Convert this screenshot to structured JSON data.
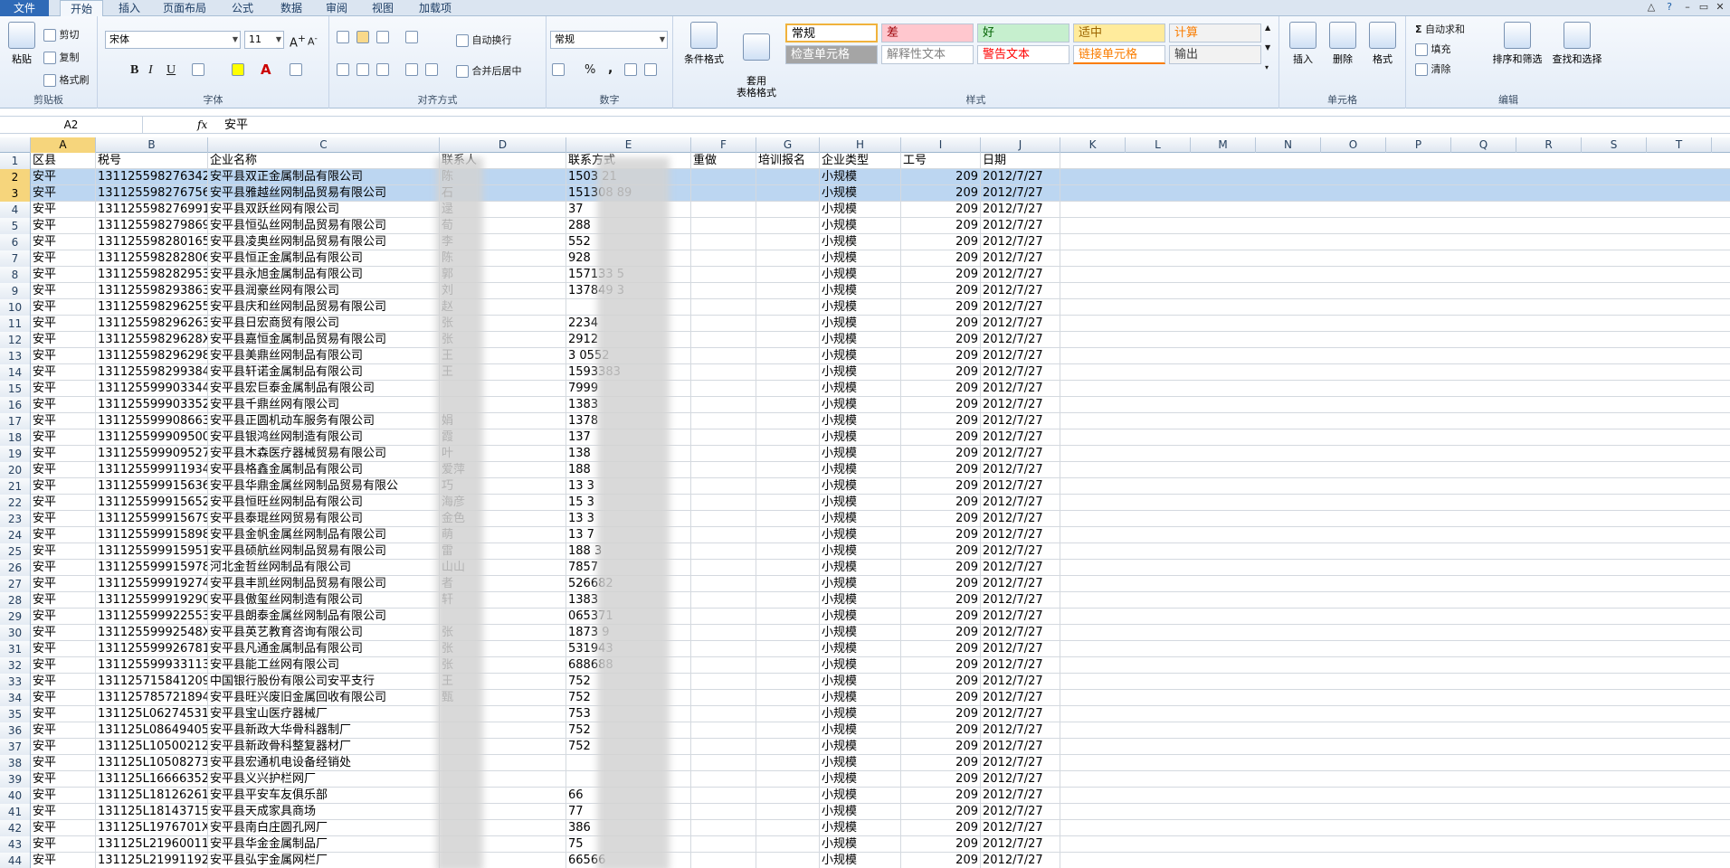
{
  "ribbon_tabs": [
    "文件",
    "开始",
    "插入",
    "页面布局",
    "公式",
    "数据",
    "审阅",
    "视图",
    "加载项"
  ],
  "clipboard": {
    "paste": "粘贴",
    "cut": "剪切",
    "copy": "复制",
    "format_painter": "格式刷",
    "label": "剪贴板"
  },
  "font": {
    "name": "宋体",
    "size": "11",
    "bold": "B",
    "italic": "I",
    "underline": "U",
    "label": "字体"
  },
  "alignment": {
    "wrap": "自动换行",
    "merge": "合并后居中",
    "label": "对齐方式"
  },
  "number": {
    "format": "常规",
    "percent": "%",
    "comma": ",",
    "label": "数字"
  },
  "styles": {
    "conditional": "条件格式",
    "table": "套用\n表格格式",
    "label": "样式",
    "items": [
      {
        "text": "常规",
        "bg": "#ffffff",
        "fg": "#000000"
      },
      {
        "text": "差",
        "bg": "#ffc7ce",
        "fg": "#9c0006"
      },
      {
        "text": "好",
        "bg": "#c6efce",
        "fg": "#006100"
      },
      {
        "text": "适中",
        "bg": "#ffeb9c",
        "fg": "#9c6500"
      },
      {
        "text": "计算",
        "bg": "#f2f2f2",
        "fg": "#fa7d00"
      },
      {
        "text": "检查单元格",
        "bg": "#a5a5a5",
        "fg": "#ffffff"
      },
      {
        "text": "解释性文本",
        "bg": "#ffffff",
        "fg": "#7f7f7f"
      },
      {
        "text": "警告文本",
        "bg": "#ffffff",
        "fg": "#ff0000"
      },
      {
        "text": "链接单元格",
        "bg": "#ffffff",
        "fg": "#fa7d00"
      },
      {
        "text": "输出",
        "bg": "#f2f2f2",
        "fg": "#3f3f3f"
      }
    ]
  },
  "cells_group": {
    "insert": "插入",
    "delete": "删除",
    "format": "格式",
    "label": "单元格"
  },
  "editing": {
    "autosum": "自动求和",
    "fill": "填充",
    "clear": "清除",
    "sort": "排序和筛选",
    "find": "查找和选择",
    "label": "编辑"
  },
  "formula_bar": {
    "name_box": "A2",
    "fx": "fx",
    "value": "安平"
  },
  "columns": [
    "A",
    "B",
    "C",
    "D",
    "E",
    "F",
    "G",
    "H",
    "I",
    "J",
    "K",
    "L",
    "M",
    "N",
    "O",
    "P",
    "Q",
    "R",
    "S",
    "T"
  ],
  "header_row": [
    "区县",
    "税号",
    "企业名称",
    "联系人",
    "联系方式",
    "重做",
    "培训报名",
    "企业类型",
    "工号",
    "日期"
  ],
  "rows": [
    [
      "2",
      "安平",
      "131125598276342",
      "安平县双正金属制品有限公司",
      "陈",
      "1503 21",
      "",
      "",
      "小规模",
      "209",
      "2012/7/27"
    ],
    [
      "3",
      "安平",
      "131125598276756",
      "安平县雅越丝网制品贸易有限公司",
      "石",
      "151308 89",
      "",
      "",
      "小规模",
      "209",
      "2012/7/27"
    ],
    [
      "4",
      "安平",
      "131125598276991",
      "安平县双跃丝网有限公司",
      "逯",
      " 37",
      "",
      "",
      "小规模",
      "209",
      "2012/7/27"
    ],
    [
      "5",
      "安平",
      "131125598279869",
      "安平县恒弘丝网制品贸易有限公司",
      "荀",
      " 288",
      "",
      "",
      "小规模",
      "209",
      "2012/7/27"
    ],
    [
      "6",
      "安平",
      "131125598280165",
      "安平县凌奥丝网制品贸易有限公司",
      "李",
      " 552",
      "",
      "",
      "小规模",
      "209",
      "2012/7/27"
    ],
    [
      "7",
      "安平",
      "131125598282806",
      "安平县恒正金属制品有限公司",
      "陈",
      " 928",
      "",
      "",
      "小规模",
      "209",
      "2012/7/27"
    ],
    [
      "8",
      "安平",
      "131125598282953",
      "安平县永旭金属制品有限公司",
      "郭",
      "157133 5",
      "",
      "",
      "小规模",
      "209",
      "2012/7/27"
    ],
    [
      "9",
      "安平",
      "131125598293863",
      "安平县润豪丝网有限公司",
      "刘",
      "137849 3",
      "",
      "",
      "小规模",
      "209",
      "2012/7/27"
    ],
    [
      "10",
      "安平",
      "131125598296255",
      "安平县庆和丝网制品贸易有限公司",
      "赵",
      "",
      "",
      "",
      "小规模",
      "209",
      "2012/7/27"
    ],
    [
      "11",
      "安平",
      "131125598296263",
      "安平县日宏商贸有限公司",
      "张",
      " 2234",
      "",
      "",
      "小规模",
      "209",
      "2012/7/27"
    ],
    [
      "12",
      "安平",
      "13112559829628X",
      "安平县嘉恒金属制品贸易有限公司",
      "张",
      " 2912",
      "",
      "",
      "小规模",
      "209",
      "2012/7/27"
    ],
    [
      "13",
      "安平",
      "131125598296298",
      "安平县美鼎丝网制品有限公司",
      "王",
      "3 0552",
      "",
      "",
      "小规模",
      "209",
      "2012/7/27"
    ],
    [
      "14",
      "安平",
      "131125598299384",
      "安平县轩诺金属制品有限公司",
      "王",
      "1593383",
      "",
      "",
      "小规模",
      "209",
      "2012/7/27"
    ],
    [
      "15",
      "安平",
      "131125599903344",
      "安平县宏巨泰金属制品有限公司",
      "",
      "7999",
      "",
      "",
      "小规模",
      "209",
      "2012/7/27"
    ],
    [
      "16",
      "安平",
      "131125599903352",
      "安平县千鼎丝网有限公司",
      "",
      "1383",
      "",
      "",
      "小规模",
      "209",
      "2012/7/27"
    ],
    [
      "17",
      "安平",
      "131125599908663",
      "安平县正圆机动车服务有限公司",
      "娟",
      "1378",
      "",
      "",
      "小规模",
      "209",
      "2012/7/27"
    ],
    [
      "18",
      "安平",
      "131125599909500",
      "安平县银鸿丝网制造有限公司",
      "霞",
      "137",
      "",
      "",
      "小规模",
      "209",
      "2012/7/27"
    ],
    [
      "19",
      "安平",
      "131125599909527",
      "安平县木森医疗器械贸易有限公司",
      "叶",
      "138",
      "",
      "",
      "小规模",
      "209",
      "2012/7/27"
    ],
    [
      "20",
      "安平",
      "131125599911934",
      "安平县格鑫金属制品有限公司",
      "爱萍",
      "188",
      "",
      "",
      "小规模",
      "209",
      "2012/7/27"
    ],
    [
      "21",
      "安平",
      "131125599915636",
      "安平县华鼎金属丝网制品贸易有限公",
      "巧",
      "13 3",
      "",
      "",
      "小规模",
      "209",
      "2012/7/27"
    ],
    [
      "22",
      "安平",
      "131125599915652",
      "安平县恒旺丝网制品有限公司",
      "海彦",
      "15 3",
      "",
      "",
      "小规模",
      "209",
      "2012/7/27"
    ],
    [
      "23",
      "安平",
      "131125599915679",
      "安平县泰琨丝网贸易有限公司",
      "金色",
      "13 3",
      "",
      "",
      "小规模",
      "209",
      "2012/7/27"
    ],
    [
      "24",
      "安平",
      "131125599915898",
      "安平县金帆金属丝网制品有限公司",
      "萌",
      "13 7",
      "",
      "",
      "小规模",
      "209",
      "2012/7/27"
    ],
    [
      "25",
      "安平",
      "131125599915951",
      "安平县硕航丝网制品贸易有限公司",
      "雷",
      "188 3",
      "",
      "",
      "小规模",
      "209",
      "2012/7/27"
    ],
    [
      "26",
      "安平",
      "131125599915978",
      "河北金哲丝网制品有限公司",
      "山山",
      "7857",
      "",
      "",
      "小规模",
      "209",
      "2012/7/27"
    ],
    [
      "27",
      "安平",
      "131125599919274",
      "安平县丰凯丝网制品贸易有限公司",
      "者",
      "526682",
      "",
      "",
      "小规模",
      "209",
      "2012/7/27"
    ],
    [
      "28",
      "安平",
      "131125599919290",
      "安平县傲玺丝网制造有限公司",
      "轩",
      "1383",
      "",
      "",
      "小规模",
      "209",
      "2012/7/27"
    ],
    [
      "29",
      "安平",
      "131125599922553",
      "安平县朗泰金属丝网制品有限公司",
      "",
      "065371",
      "",
      "",
      "小规模",
      "209",
      "2012/7/27"
    ],
    [
      "30",
      "安平",
      "13112559992548X",
      "安平县英艺教育咨询有限公司",
      "张",
      "1873 9",
      "",
      "",
      "小规模",
      "209",
      "2012/7/27"
    ],
    [
      "31",
      "安平",
      "131125599926781",
      "安平县凡通金属制品有限公司",
      "张",
      "531943",
      "",
      "",
      "小规模",
      "209",
      "2012/7/27"
    ],
    [
      "32",
      "安平",
      "131125599933113",
      "安平县能工丝网有限公司",
      "张",
      "688688",
      "",
      "",
      "小规模",
      "209",
      "2012/7/27"
    ],
    [
      "33",
      "安平",
      "131125715841209",
      "中国银行股份有限公司安平支行",
      "王",
      "752",
      "",
      "",
      "小规模",
      "209",
      "2012/7/27"
    ],
    [
      "34",
      "安平",
      "131125785721894",
      "安平县旺兴废旧金属回收有限公司",
      "甄",
      "752",
      "",
      "",
      "小规模",
      "209",
      "2012/7/27"
    ],
    [
      "35",
      "安平",
      "131125L06274531",
      "安平县宝山医疗器械厂",
      "",
      "753",
      "",
      "",
      "小规模",
      "209",
      "2012/7/27"
    ],
    [
      "36",
      "安平",
      "131125L08649405",
      "安平县新政大华骨科器制厂",
      "",
      "752",
      "",
      "",
      "小规模",
      "209",
      "2012/7/27"
    ],
    [
      "37",
      "安平",
      "131125L10500212",
      "安平县新政骨科整复器材厂",
      "",
      "752",
      "",
      "",
      "小规模",
      "209",
      "2012/7/27"
    ],
    [
      "38",
      "安平",
      "131125L10508273",
      "安平县宏通机电设备经销处",
      "",
      "",
      "",
      "",
      "小规模",
      "209",
      "2012/7/27"
    ],
    [
      "39",
      "安平",
      "131125L16666352",
      "安平县义兴护栏网厂",
      "",
      "",
      "",
      "",
      "小规模",
      "209",
      "2012/7/27"
    ],
    [
      "40",
      "安平",
      "131125L18126261",
      "安平县平安车友俱乐部",
      "",
      "66",
      "",
      "",
      "小规模",
      "209",
      "2012/7/27"
    ],
    [
      "41",
      "安平",
      "131125L18143715",
      "安平县天成家具商场",
      "",
      "77",
      "",
      "",
      "小规模",
      "209",
      "2012/7/27"
    ],
    [
      "42",
      "安平",
      "131125L1976701X",
      "安平县南白庄圆孔网厂",
      "",
      "386",
      "",
      "",
      "小规模",
      "209",
      "2012/7/27"
    ],
    [
      "43",
      "安平",
      "131125L21960011",
      "安平县华金金属制品厂",
      "",
      "75",
      "",
      "",
      "小规模",
      "209",
      "2012/7/27"
    ],
    [
      "44",
      "安平",
      "131125L21991192",
      "安平县弘宇金属网栏厂",
      "",
      "66566",
      "",
      "",
      "小规模",
      "209",
      "2012/7/27"
    ]
  ]
}
